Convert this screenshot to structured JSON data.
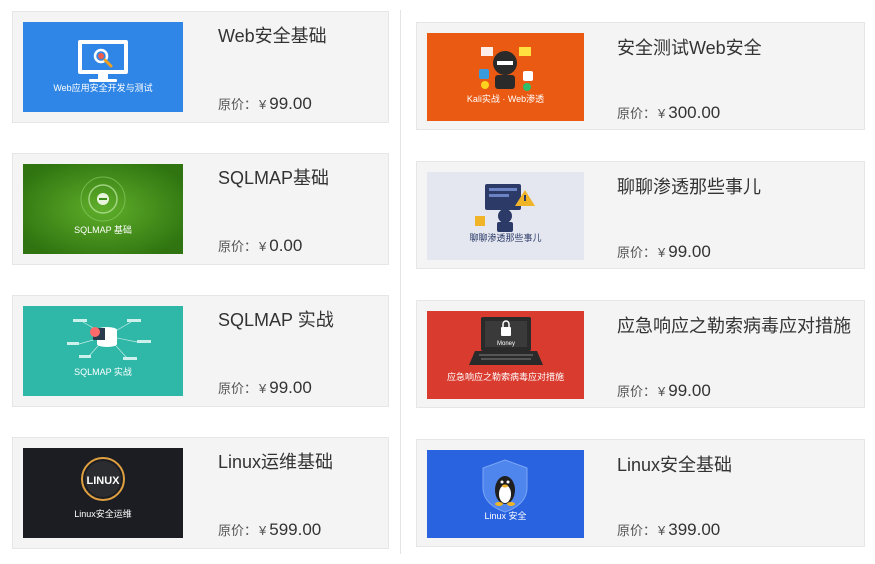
{
  "courses": [
    {
      "title": "Web安全基础",
      "price_label": "原价：",
      "currency": "¥",
      "price": "99.00",
      "thumb_caption": "Web应用安全开发与测试",
      "thumb_color": "#2f86e6",
      "icon": "monitor-search-icon"
    },
    {
      "title": "SQLMAP基础",
      "price_label": "原价：",
      "currency": "¥",
      "price": "0.00",
      "thumb_caption": "SQLMAP 基础",
      "thumb_color": "#3f8f1a",
      "icon": "target-icon"
    },
    {
      "title": "SQLMAP 实战",
      "price_label": "原价：",
      "currency": "¥",
      "price": "99.00",
      "thumb_caption": "SQLMAP  实战",
      "thumb_color": "#2fb8a8",
      "icon": "database-mindmap-icon"
    },
    {
      "title": "Linux运维基础",
      "price_label": "原价：",
      "currency": "¥",
      "price": "599.00",
      "thumb_caption": "Linux安全运维",
      "thumb_color": "#1b1d22",
      "icon": "linux-badge-icon",
      "thumb_badge": "LINUX"
    },
    {
      "title": "安全测试Web安全",
      "price_label": "原价：",
      "currency": "¥",
      "price": "300.00",
      "thumb_caption": "Kali实战 · Web渗透",
      "thumb_color": "#ea5a12",
      "icon": "hacker-icon"
    },
    {
      "title": "聊聊渗透那些事儿",
      "price_label": "原价：",
      "currency": "¥",
      "price": "99.00",
      "thumb_caption": "聊聊渗透那些事儿",
      "thumb_color": "#e4e7f0",
      "icon": "hacker-warning-icon"
    },
    {
      "title": "应急响应之勒索病毒应对措施",
      "price_label": "原价：",
      "currency": "¥",
      "price": "99.00",
      "thumb_caption": "应急响应之勒索病毒应对措施",
      "thumb_color": "#d93b2f",
      "icon": "laptop-lock-icon",
      "thumb_badge": "Money"
    },
    {
      "title": "Linux安全基础",
      "price_label": "原价：",
      "currency": "¥",
      "price": "399.00",
      "thumb_caption": "Linux 安全",
      "thumb_color": "#2a63e0",
      "icon": "tux-shield-icon"
    }
  ]
}
